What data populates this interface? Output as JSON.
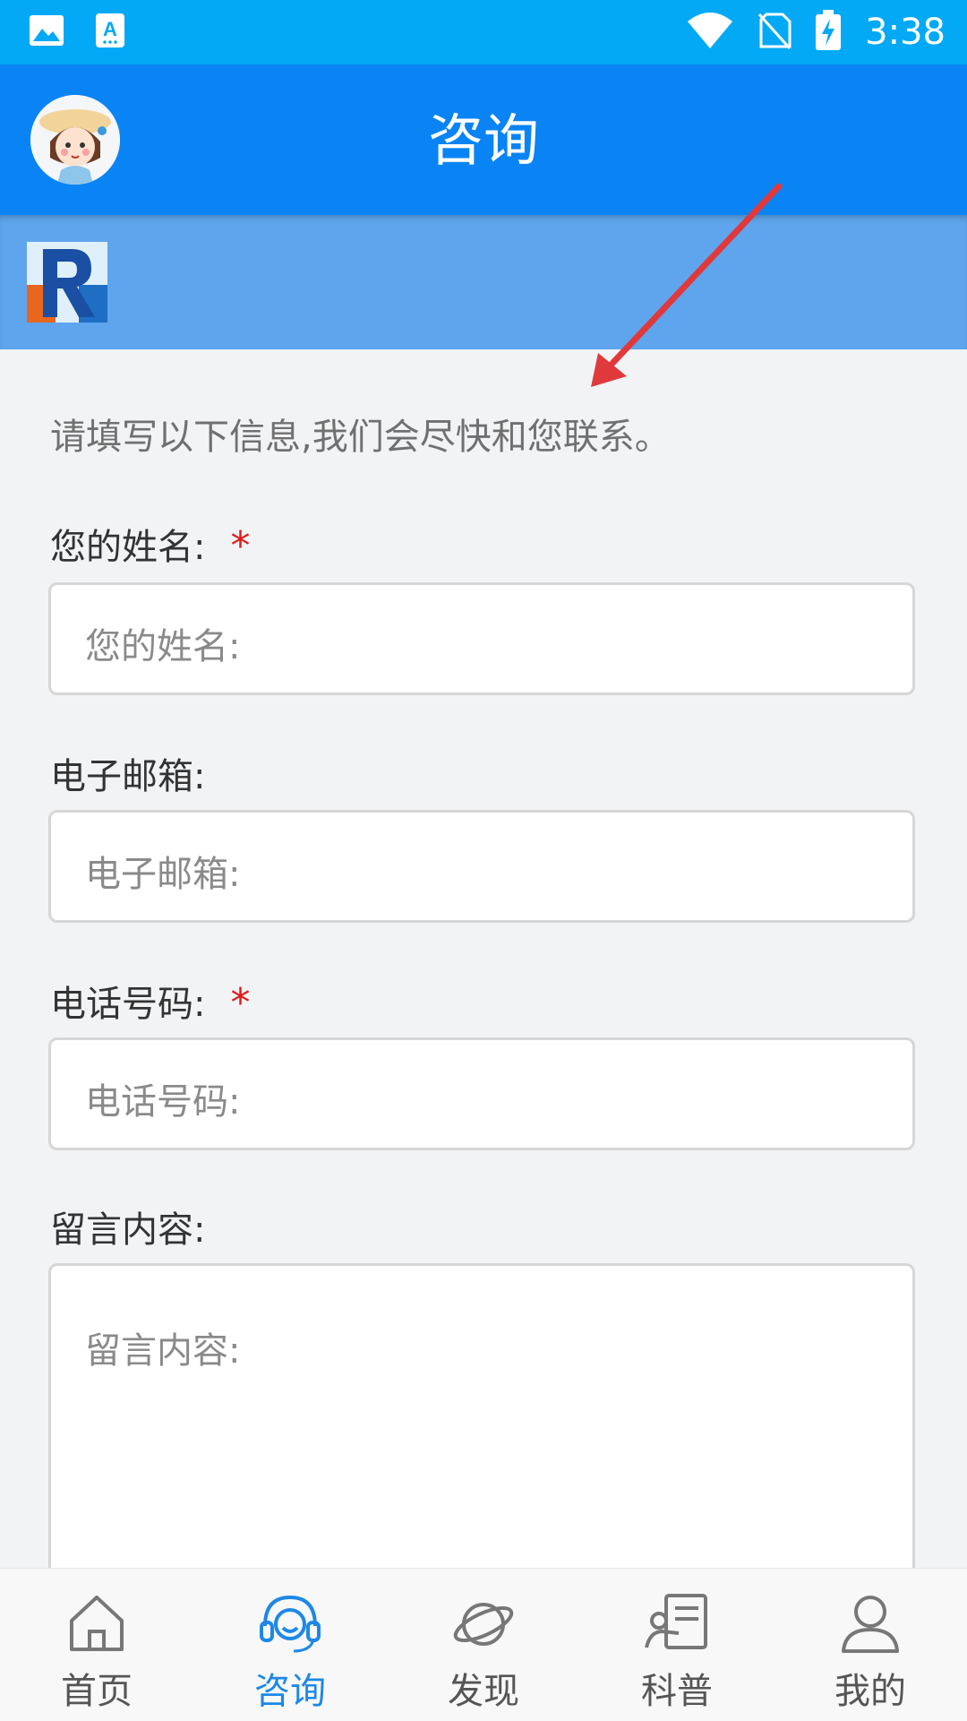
{
  "status_bar": {
    "time": "3:38",
    "icons": [
      "image-icon",
      "a-app-icon",
      "wifi-icon",
      "no-sim-icon",
      "battery-charging-icon"
    ]
  },
  "app_bar": {
    "title": "咨询"
  },
  "form": {
    "intro": "请填写以下信息,我们会尽快和您联系。",
    "name": {
      "label": "您的姓名:",
      "placeholder": "您的姓名:",
      "required_mark": "*"
    },
    "email": {
      "label": "电子邮箱:",
      "placeholder": "电子邮箱:"
    },
    "phone": {
      "label": "电话号码:",
      "placeholder": "电话号码:",
      "required_mark": "*"
    },
    "message": {
      "label": "留言内容:",
      "placeholder": "留言内容:"
    }
  },
  "bottom_nav": {
    "items": [
      {
        "label": "首页",
        "icon": "home-icon"
      },
      {
        "label": "咨询",
        "icon": "headset-icon",
        "active": true
      },
      {
        "label": "发现",
        "icon": "planet-icon"
      },
      {
        "label": "科普",
        "icon": "reading-icon"
      },
      {
        "label": "我的",
        "icon": "user-icon"
      }
    ]
  },
  "colors": {
    "status_bar": "#03a9f4",
    "app_bar": "#0a84f4",
    "banner": "#5ea5ee",
    "active": "#1e88e5",
    "required": "#e01b1b"
  }
}
